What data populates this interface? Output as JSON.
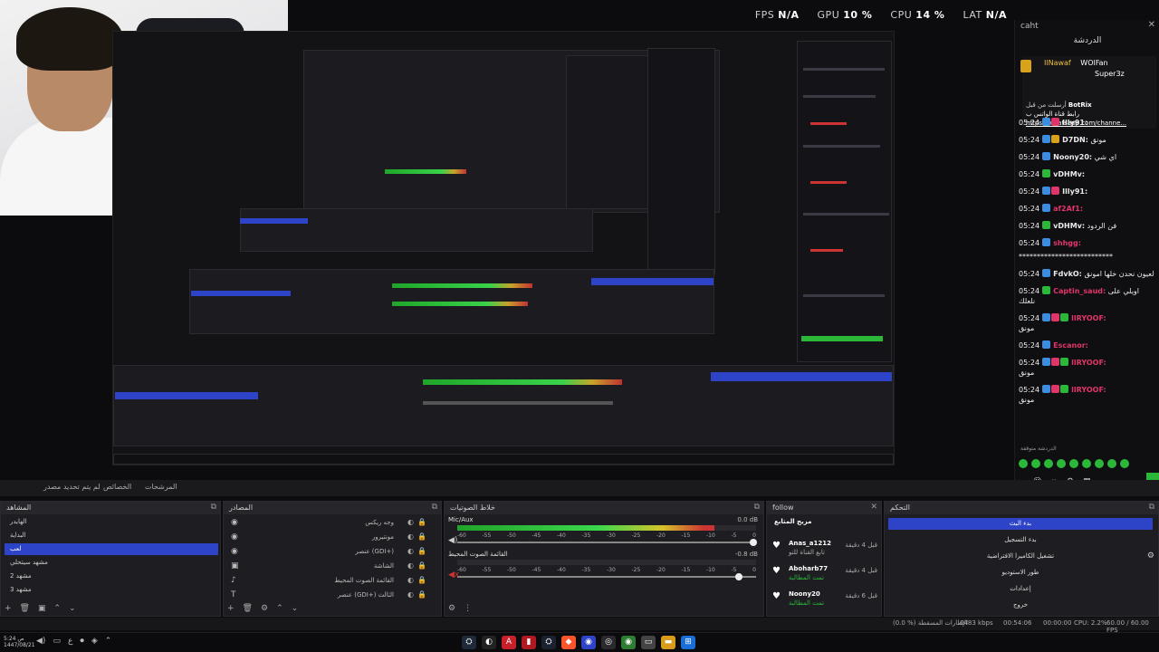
{
  "stats": {
    "fps_label": "FPS",
    "fps_value": "N/A",
    "gpu_label": "GPU",
    "gpu_value": "10 %",
    "cpu_label": "CPU",
    "cpu_value": "14 %",
    "lat_label": "LAT",
    "lat_value": "N/A"
  },
  "chat": {
    "tab": "caht",
    "title": "الدردشة",
    "pinned": [
      {
        "user": "IlNawaf",
        "text": "WOlFan"
      },
      {
        "user": "",
        "text": "Super3z"
      }
    ],
    "pinned_msg": {
      "head": "أرسلت من قبل",
      "user": "BotRix",
      "line1": "رابط قناة الواتس ب",
      "link": "https://whatsapp.com/channe..."
    },
    "messages": [
      {
        "time": "05:24",
        "user": "Illy91:",
        "color": "#ffffff",
        "text": ""
      },
      {
        "time": "05:24",
        "user": "D7DN:",
        "color": "#ffffff",
        "text": "مونق"
      },
      {
        "time": "05:24",
        "user": "Noony20:",
        "color": "#ffffff",
        "text": "اي شي"
      },
      {
        "time": "05:24",
        "user": "vDHMv:",
        "color": "#ffffff",
        "text": ""
      },
      {
        "time": "05:24",
        "user": "Illy91:",
        "color": "#ffffff",
        "text": ""
      },
      {
        "time": "05:24",
        "user": "af2Af1:",
        "color": "#e0356a",
        "text": ""
      },
      {
        "time": "05:24",
        "user": "vDHMv:",
        "color": "#ffffff",
        "text": "فن الردود"
      },
      {
        "time": "05:24",
        "user": "shhgg:",
        "color": "#e0356a",
        "text": ""
      },
      {
        "time": "",
        "user": "",
        "color": "#ffffff",
        "text": "**************************"
      },
      {
        "time": "05:24",
        "user": "FdvkO:",
        "color": "#ffffff",
        "text": "لعيون نحدن خلها امونق"
      },
      {
        "time": "05:24",
        "user": "Captin_saud:",
        "color": "#e0356a",
        "text": "اويلي على"
      },
      {
        "time": "",
        "user": "",
        "color": "#ffffff",
        "text": "نلعلك"
      },
      {
        "time": "05:24",
        "user": "llRYOOF:",
        "color": "#e0356a",
        "text": ""
      },
      {
        "time": "",
        "user": "",
        "color": "#ffffff",
        "text": "مونق"
      },
      {
        "time": "05:24",
        "user": "Escanor:",
        "color": "#e0356a",
        "text": ""
      },
      {
        "time": "05:24",
        "user": "llRYOOF:",
        "color": "#e0356a",
        "text": ""
      },
      {
        "time": "",
        "user": "",
        "color": "#ffffff",
        "text": "مونق"
      },
      {
        "time": "05:24",
        "user": "llRYOOF:",
        "color": "#e0356a",
        "text": ""
      },
      {
        "time": "",
        "user": "",
        "color": "#ffffff",
        "text": "مونق"
      }
    ],
    "paused": "الدردشة متوقفة"
  },
  "obs": {
    "bar_left": "لم يتم تحديد مصدر",
    "bar_props": "الخصائص",
    "bar_filters": "المرشحات",
    "scenes_title": "المشاهد",
    "scenes": [
      "الهايدر",
      "البداية",
      "لعب",
      "مشهد سيتحلي",
      "مشهد 2",
      "مشهد 3"
    ],
    "sources_title": "المصادر",
    "sources": [
      "وجه ريكس",
      "مونتيرور",
      "عنصر (GDI+)",
      "الشاشة",
      "القائمة الصوت المحيط",
      "عنصر (GDI+) الثالث"
    ],
    "audio_title": "خلاط الصوتيات",
    "audio_ch1": "Mic/Aux",
    "audio_ch1_db": "0.0 dB",
    "audio_ch2": "القائمة الصوت المحيط",
    "audio_ch2_db": "-0.8 dB",
    "ticks": [
      "-60",
      "-55",
      "-50",
      "-45",
      "-40",
      "-35",
      "-30",
      "-25",
      "-20",
      "-15",
      "-10",
      "-5",
      "0"
    ],
    "follow_title": "follow",
    "follow_sub": "مزيج المتابع",
    "followers": [
      {
        "name": "Anas_a1212",
        "sub": "تابع القناة للتو",
        "ago": "قبل 4 دقيقة"
      },
      {
        "name": "Aboharb77",
        "sub": "تمت المطالبة",
        "ago": "قبل 4 دقيقة"
      },
      {
        "name": "Noony20",
        "sub": "تمت المطالبة",
        "ago": "قبل 6 دقيقة"
      }
    ],
    "controls_title": "التحكم",
    "controls": [
      "بدء البث",
      "بدء التسجيل",
      "تشغيل الكاميرا الافتراضية",
      "طور الاستوديو",
      "إعدادات",
      "خروج"
    ],
    "status_left": "(0.0 %) الإطارات المسقطة",
    "status_kbps": "6483 kbps",
    "status_time": "00:54:06",
    "status_rec": "00:00:00",
    "status_cpu": "CPU: 2.2%",
    "status_fps": "60.00 / 60.00 FPS"
  },
  "taskbar": {
    "time": "5:24 ص",
    "date": "1447/08/21"
  }
}
